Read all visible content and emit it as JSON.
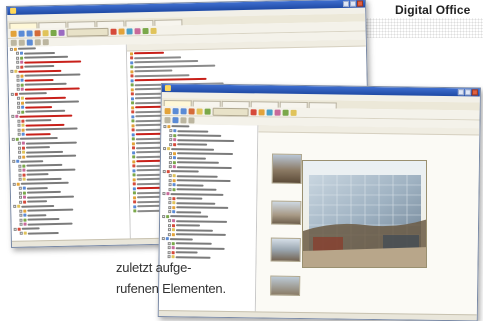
{
  "brand": {
    "name": "Digital Office"
  },
  "caption": {
    "line1": "zuletzt aufge-",
    "line2": "rufenen Elementen."
  },
  "back_window": {
    "title": "",
    "menu": [
      "",
      "",
      "",
      "",
      "",
      "",
      ""
    ],
    "tabs": [
      "",
      "",
      "",
      "",
      "",
      ""
    ],
    "status": ""
  },
  "front_window": {
    "title": "",
    "menu": [
      "",
      "",
      "",
      "",
      "",
      "",
      ""
    ],
    "tabs": [
      "",
      "",
      "",
      "",
      "",
      ""
    ],
    "status": ""
  },
  "colors": {
    "titlebar": "#2a56b8",
    "accent_red": "#c8201a",
    "tab_text": "#a03010",
    "photo_bg": "#f7efc0"
  }
}
